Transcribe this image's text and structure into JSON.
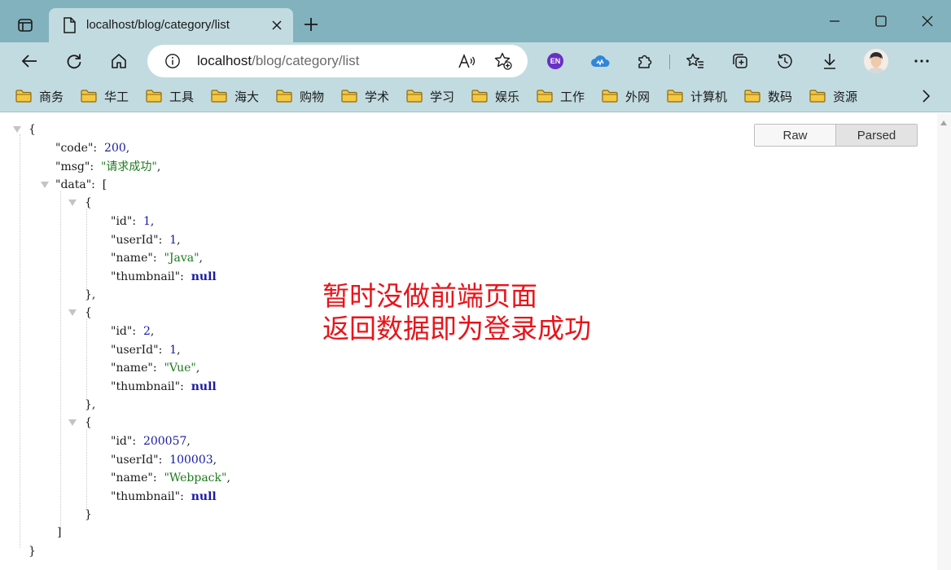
{
  "window": {
    "tab_title": "localhost/blog/category/list",
    "new_tab_icon": "plus-icon",
    "controls": [
      "minimize-icon",
      "maximize-icon",
      "close-icon"
    ]
  },
  "toolbar": {
    "url_host": "localhost",
    "url_path": "/blog/category/list",
    "extension_en_label": "EN"
  },
  "favorites": [
    {
      "label": "商务"
    },
    {
      "label": "华工"
    },
    {
      "label": "工具"
    },
    {
      "label": "海大"
    },
    {
      "label": "购物"
    },
    {
      "label": "学术"
    },
    {
      "label": "学习"
    },
    {
      "label": "娱乐"
    },
    {
      "label": "工作"
    },
    {
      "label": "外网"
    },
    {
      "label": "计算机"
    },
    {
      "label": "数码"
    },
    {
      "label": "资源"
    }
  ],
  "viewer": {
    "raw_label": "Raw",
    "parsed_label": "Parsed"
  },
  "json": {
    "code": "200",
    "msg": "\"请求成功\"",
    "items": [
      {
        "id": "1",
        "userId": "1",
        "name": "\"Java\"",
        "thumbnail": "null"
      },
      {
        "id": "2",
        "userId": "1",
        "name": "\"Vue\"",
        "thumbnail": "null"
      },
      {
        "id": "200057",
        "userId": "100003",
        "name": "\"Webpack\"",
        "thumbnail": "null"
      }
    ]
  },
  "note": {
    "line1": "暂时没做前端页面",
    "line2": "返回数据即为登录成功"
  },
  "colors": {
    "titlebar": "#82b2bd",
    "toolbar": "#c2dbe0",
    "note": "#e8141a",
    "json_number": "#1a1aa6",
    "json_string": "#1e7a1e"
  }
}
